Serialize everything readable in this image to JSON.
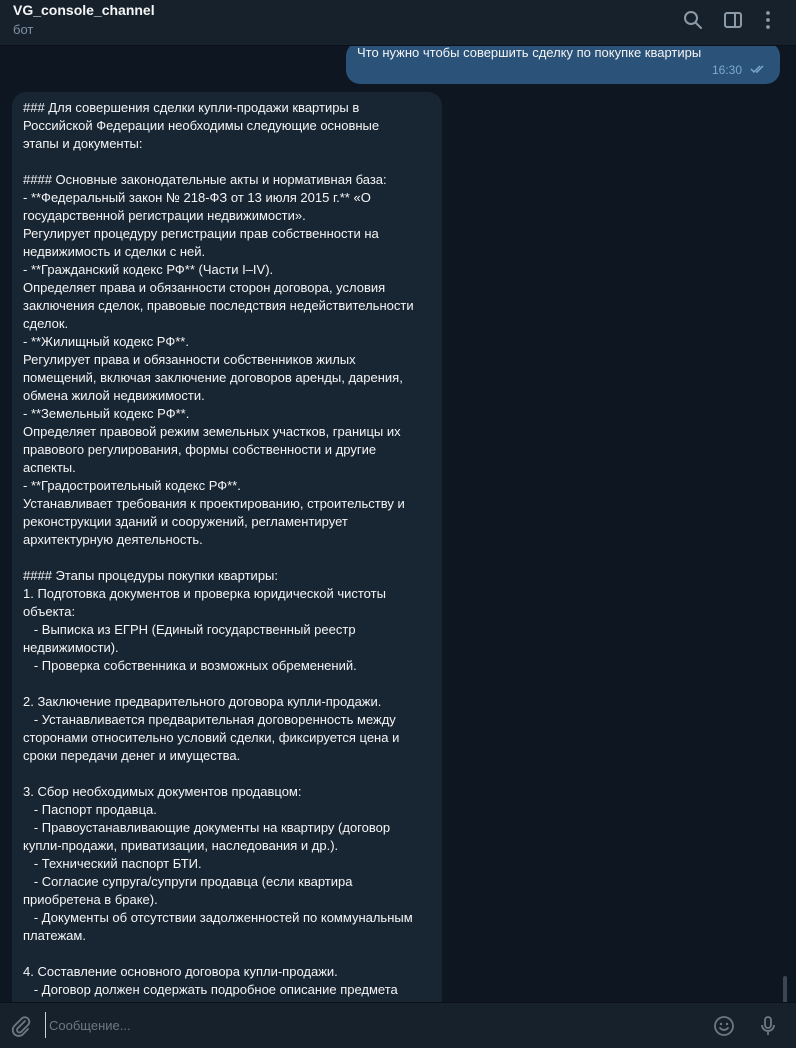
{
  "header": {
    "title": "VG_console_channel",
    "subtitle": "бот",
    "icons": [
      "search-icon",
      "sidebar-toggle-icon",
      "more-vertical-icon"
    ]
  },
  "outgoing": {
    "text": "Что нужно чтобы совершить сделку по покупке квартиры",
    "time": "16:30",
    "status_icon": "double-check-icon"
  },
  "incoming": {
    "lines": [
      "### Для совершения сделки купли-продажи квартиры в",
      "Российской Федерации необходимы следующие основные",
      "этапы и документы:",
      "",
      "#### Основные законодательные акты и нормативная база:",
      "- **Федеральный закон № 218-ФЗ от 13 июля 2015 г.** «О",
      "государственной регистрации недвижимости».",
      "Регулирует процедуру регистрации прав собственности на",
      "недвижимость и сделки с ней.",
      "- **Гражданский кодекс РФ** (Части I–IV).",
      "Определяет права и обязанности сторон договора, условия",
      "заключения сделок, правовые последствия недействительности",
      "сделок.",
      "- **Жилищный кодекс РФ**.",
      "Регулирует права и обязанности собственников жилых",
      "помещений, включая заключение договоров аренды, дарения,",
      "обмена жилой недвижимости.",
      "- **Земельный кодекс РФ**.",
      "Определяет правовой режим земельных участков, границы их",
      "правового регулирования, формы собственности и другие",
      "аспекты.",
      "- **Градостроительный кодекс РФ**.",
      "Устанавливает требования к проектированию, строительству и",
      "реконструкции зданий и сооружений, регламентирует",
      "архитектурную деятельность.",
      "",
      "#### Этапы процедуры покупки квартиры:",
      "1. Подготовка документов и проверка юридической чистоты",
      "объекта:",
      "   - Выписка из ЕГРН (Единый государственный реестр",
      "недвижимости).",
      "   - Проверка собственника и возможных обременений.",
      "",
      "2. Заключение предварительного договора купли-продажи.",
      "   - Устанавливается предварительная договоренность между",
      "сторонами относительно условий сделки, фиксируется цена и",
      "сроки передачи денег и имущества.",
      "",
      "3. Сбор необходимых документов продавцом:",
      "   - Паспорт продавца.",
      "   - Правоустанавливающие документы на квартиру (договор",
      "купли-продажи, приватизации, наследования и др.).",
      "   - Технический паспорт БТИ.",
      "   - Согласие супруга/супруги продавца (если квартира",
      "приобретена в браке).",
      "   - Документы об отсутствии задолженностей по коммунальным",
      "платежам.",
      "",
      "4. Составление основного договора купли-продажи.",
      "   - Договор должен содержать подробное описание предмета"
    ]
  },
  "composer": {
    "placeholder": "Сообщение...",
    "icons": [
      "paperclip-icon",
      "emoji-icon",
      "microphone-icon"
    ]
  },
  "colors": {
    "background": "#0e1621",
    "header": "#17212b",
    "outgoing_bubble": "#2b5278",
    "incoming_bubble": "#182533",
    "muted_text": "#7f91a4",
    "time_text": "#7da8d3"
  }
}
